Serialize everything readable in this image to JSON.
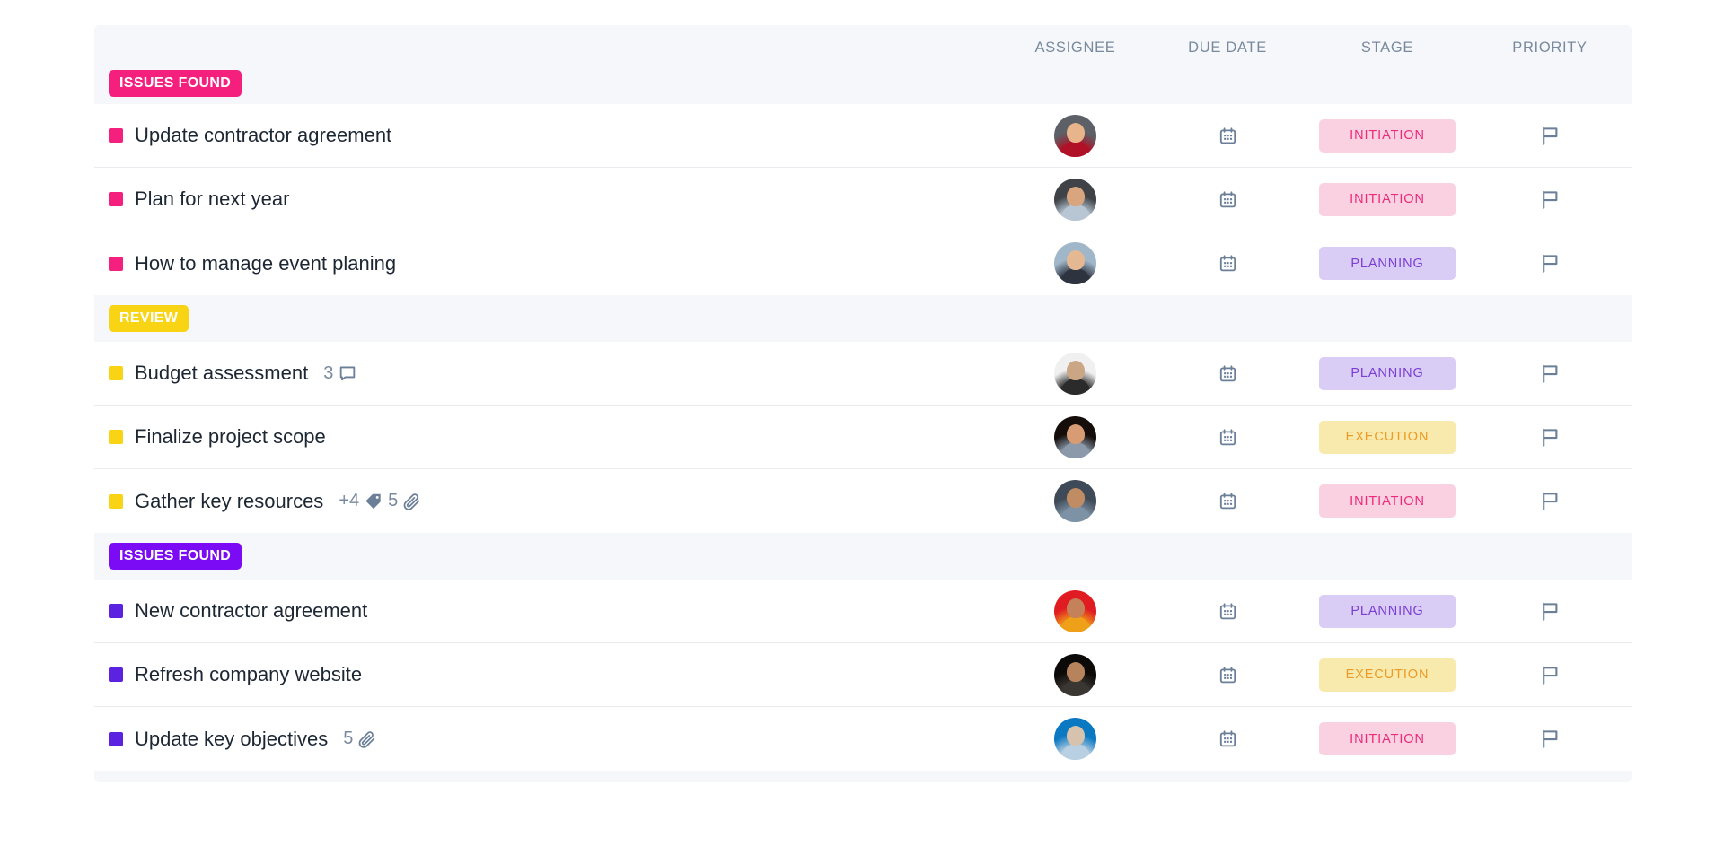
{
  "columns": {
    "assignee": "ASSIGNEE",
    "due_date": "DUE DATE",
    "stage": "STAGE",
    "priority": "PRIORITY"
  },
  "stage_styles": {
    "INITIATION": {
      "bg": "#f9d1e1",
      "fg": "#ec2a7b"
    },
    "PLANNING": {
      "bg": "#d9ccf5",
      "fg": "#7b3fd4"
    },
    "EXECUTION": {
      "bg": "#f8e9ad",
      "fg": "#eb9b26"
    }
  },
  "icon_color": "#6b7f99",
  "groups": [
    {
      "label": "ISSUES FOUND",
      "chip_color": "#f51f7e",
      "marker_color": "#f51f7e",
      "tasks": [
        {
          "title": "Update contractor agreement",
          "stage": "INITIATION",
          "avatar": {
            "skin": "#e8b48c",
            "cloth": "#b01127",
            "bg": "#5d6066"
          },
          "meta": []
        },
        {
          "title": "Plan for next year",
          "stage": "INITIATION",
          "avatar": {
            "skin": "#d9a57e",
            "cloth": "#b8c6d4",
            "bg": "#3f4347"
          },
          "meta": []
        },
        {
          "title": "How to manage event planing",
          "stage": "PLANNING",
          "avatar": {
            "skin": "#e5b894",
            "cloth": "#2e3340",
            "bg": "#9fb7c9"
          },
          "meta": []
        }
      ]
    },
    {
      "label": "REVIEW",
      "chip_color": "#f9d414",
      "marker_color": "#f9d414",
      "tasks": [
        {
          "title": "Budget assessment",
          "stage": "PLANNING",
          "avatar": {
            "skin": "#caa684",
            "cloth": "#2b2b2b",
            "bg": "#f0f0f0"
          },
          "meta": [
            {
              "count": "3",
              "icon": "comment-icon"
            }
          ]
        },
        {
          "title": "Finalize project scope",
          "stage": "EXECUTION",
          "avatar": {
            "skin": "#d79c74",
            "cloth": "#8b99ab",
            "bg": "#140d09"
          },
          "meta": []
        },
        {
          "title": "Gather key resources",
          "stage": "INITIATION",
          "avatar": {
            "skin": "#c08c64",
            "cloth": "#7e92a6",
            "bg": "#3e4a57"
          },
          "meta": [
            {
              "count": "+4",
              "icon": "tag-icon"
            },
            {
              "count": "5",
              "icon": "attachment-icon"
            }
          ]
        }
      ]
    },
    {
      "label": "ISSUES FOUND",
      "chip_color": "#7c0bf5",
      "marker_color": "#5b22e0",
      "tasks": [
        {
          "title": "New contractor agreement",
          "stage": "PLANNING",
          "avatar": {
            "skin": "#c4815a",
            "cloth": "#efa019",
            "bg": "#e01b22"
          },
          "meta": []
        },
        {
          "title": "Refresh company website",
          "stage": "EXECUTION",
          "avatar": {
            "skin": "#b7835d",
            "cloth": "#3a3632",
            "bg": "#0c0a08"
          },
          "meta": []
        },
        {
          "title": "Update key objectives",
          "stage": "INITIATION",
          "avatar": {
            "skin": "#d7c3ad",
            "cloth": "#b9cfe2",
            "bg": "#0b79c2"
          },
          "meta": [
            {
              "count": "5",
              "icon": "attachment-icon"
            }
          ]
        }
      ]
    }
  ]
}
